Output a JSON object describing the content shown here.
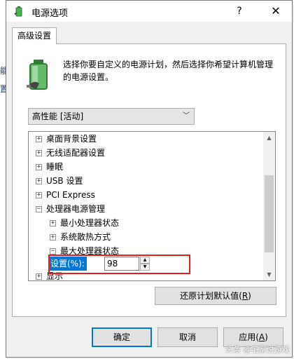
{
  "window": {
    "title": "电源选项",
    "help_label": "?",
    "close_label": "✕"
  },
  "tab": {
    "label": "高级设置"
  },
  "description": "选择你要自定义的电源计划，然后选择你希望计算机管理的电源设置。",
  "plan": {
    "selected": "高性能 [活动]"
  },
  "tree": {
    "items": [
      {
        "label": "桌面背景设置",
        "expander": "+"
      },
      {
        "label": "无线适配器设置",
        "expander": "+"
      },
      {
        "label": "睡眠",
        "expander": "+"
      },
      {
        "label": "USB 设置",
        "expander": "+"
      },
      {
        "label": "PCI Express",
        "expander": "+"
      },
      {
        "label": "处理器电源管理",
        "expander": "−"
      },
      {
        "label": "最小处理器状态",
        "expander": "+"
      },
      {
        "label": "系统散热方式",
        "expander": "+"
      },
      {
        "label": "最大处理器状态",
        "expander": "−"
      },
      {
        "label": "显示",
        "expander": "+"
      }
    ]
  },
  "setting": {
    "label": "设置(%):",
    "value": "98"
  },
  "buttons": {
    "restore_pre": "还原计划默认值(",
    "restore_key": "R",
    "restore_post": ")",
    "ok": "确定",
    "cancel": "取消",
    "apply_pre": "应用(",
    "apply_key": "A",
    "apply_post": ")"
  },
  "watermark": "头条 @宅家说游戏",
  "colors": {
    "selection": "#0078d7",
    "highlight_box": "#e02020"
  }
}
